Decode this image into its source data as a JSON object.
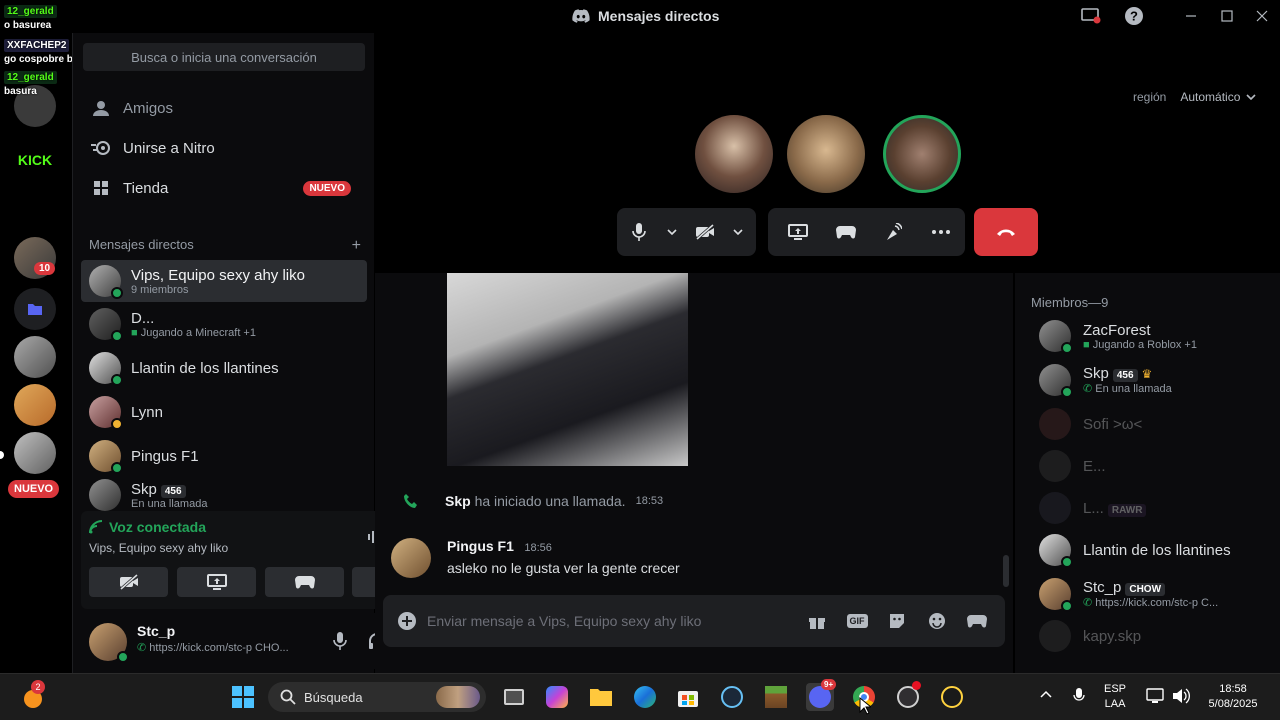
{
  "window": {
    "title": "Mensajes directos"
  },
  "overlay_chat": [
    {
      "user": "12_gerald",
      "text": "o basurea"
    },
    {
      "user": "XXFACHEP2",
      "text": "go cospobre bebe"
    },
    {
      "user": "12_gerald",
      "text": "basura"
    }
  ],
  "servers": {
    "kick_label": "KICK",
    "mention_count": "10",
    "new_badge": "NUEVO"
  },
  "sidebar": {
    "search_placeholder": "Busca o inicia una conversación",
    "nav": [
      {
        "label": "Amigos"
      },
      {
        "label": "Unirse a Nitro"
      },
      {
        "label": "Tienda",
        "badge": "NUEVO"
      }
    ],
    "dm_header": "Mensajes directos",
    "dm_add": "+",
    "dms": [
      {
        "name": "Vips, Equipo sexy ahy liko",
        "sub": "9 miembros"
      },
      {
        "name": "D...",
        "sub": "Jugando a Minecraft +1"
      },
      {
        "name": "Llantin de los llantines",
        "sub": ""
      },
      {
        "name": "Lynn",
        "sub": ""
      },
      {
        "name": "Pingus F1",
        "sub": ""
      },
      {
        "name": "Skp",
        "tag": "456",
        "sub": "En una llamada"
      }
    ]
  },
  "voice": {
    "title": "Voz conectada",
    "channel": "Vips, Equipo sexy ahy liko"
  },
  "user_panel": {
    "name": "Stc_p",
    "status": "https://kick.com/stc-p CHO..."
  },
  "call": {
    "region_label": "región",
    "region_value": "Automático"
  },
  "messages": {
    "system": {
      "author": "Skp",
      "text": "ha iniciado una llamada.",
      "time": "18:53"
    },
    "msg": {
      "author": "Pingus F1",
      "time": "18:56",
      "text": "asleko no le gusta ver la gente crecer"
    }
  },
  "composer": {
    "placeholder": "Enviar mensaje a Vips, Equipo sexy ahy liko",
    "gif_label": "GIF"
  },
  "members": {
    "title": "Miembros—9",
    "list": [
      {
        "name": "ZacForest",
        "sub": "Jugando a Roblox +1",
        "dim": false
      },
      {
        "name": "Skp",
        "tag": "456",
        "sub": "En una llamada",
        "dim": false
      },
      {
        "name": "Sofi >ω<",
        "sub": "",
        "dim": true
      },
      {
        "name": "E...",
        "sub": "",
        "dim": true
      },
      {
        "name": "L...",
        "tag": "RAWR",
        "sub": "",
        "dim": true
      },
      {
        "name": "Llantin de los llantines",
        "sub": "",
        "dim": false
      },
      {
        "name": "Stc_p",
        "tag": "CHOW",
        "sub": "https://kick.com/stc-p C...",
        "dim": false
      },
      {
        "name": "kapy.skp",
        "sub": "",
        "dim": true
      }
    ]
  },
  "taskbar": {
    "search": "Búsqueda",
    "weather_badge": "2",
    "discord_badge": "9+",
    "lang": "ESP",
    "lang_sub": "LAA",
    "time": "18:58",
    "date": "5/08/2025"
  },
  "colors": {
    "green": "#23a55a",
    "red": "#da373c",
    "kick": "#53fc18"
  }
}
